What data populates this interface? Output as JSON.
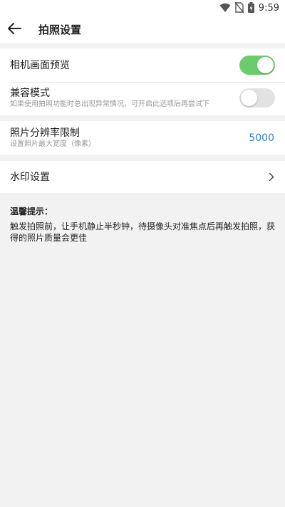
{
  "status_bar": {
    "time": "9:59",
    "icons": [
      "wifi-icon",
      "no-sim-icon",
      "battery-charging-icon"
    ]
  },
  "app_bar": {
    "title": "拍照设置",
    "back_icon": "arrow-left-icon"
  },
  "settings": {
    "preview": {
      "label": "相机画面预览",
      "enabled": true
    },
    "compat": {
      "label": "兼容模式",
      "description": "如果使用拍照功能时总出现异常情况，可开启此选项后再尝试下",
      "enabled": false
    },
    "resolution": {
      "label": "照片分辨率限制",
      "description": "设置照片最大宽度（像素）",
      "value": "5000"
    },
    "watermark": {
      "label": "水印设置",
      "icon": "chevron-right-icon"
    }
  },
  "tips": {
    "title": "温馨提示：",
    "body": "触发拍照前，让手机静止半秒钟，待摄像头对准焦点后再触发拍照，获得的照片质量会更佳"
  },
  "colors": {
    "toggle_on": "#6ccc6c",
    "toggle_off": "#e2e2e2",
    "link": "#2a7dd6",
    "background": "#f2f2f2"
  }
}
